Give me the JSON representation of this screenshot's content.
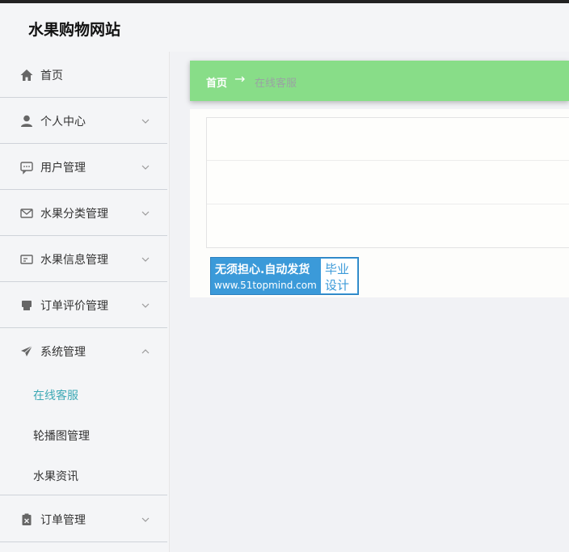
{
  "header": {
    "site_title": "水果购物网站"
  },
  "sidebar": {
    "items": [
      {
        "label": "首页",
        "icon": "home-icon",
        "expandable": false
      },
      {
        "label": "个人中心",
        "icon": "user-icon",
        "expandable": true
      },
      {
        "label": "用户管理",
        "icon": "chat-icon",
        "expandable": true
      },
      {
        "label": "水果分类管理",
        "icon": "mail-icon",
        "expandable": true
      },
      {
        "label": "水果信息管理",
        "icon": "card-icon",
        "expandable": true
      },
      {
        "label": "订单评价管理",
        "icon": "printer-icon",
        "expandable": true
      },
      {
        "label": "系统管理",
        "icon": "send-icon",
        "expandable": true,
        "expanded": true
      },
      {
        "label": "订单管理",
        "icon": "clipboard-icon",
        "expandable": true
      }
    ],
    "submenu": [
      {
        "label": "在线客服",
        "active": true
      },
      {
        "label": "轮播图管理",
        "active": false
      },
      {
        "label": "水果资讯",
        "active": false
      }
    ]
  },
  "breadcrumb": {
    "home": "首页",
    "separator": "→",
    "current": "在线客服"
  },
  "ad": {
    "line1": "无须担心.自动发货",
    "line2": "www.51topmind.com",
    "right1": "毕业",
    "right2": "设计"
  },
  "colors": {
    "breadcrumb_bg": "#88dd88",
    "active_submenu": "#3ea9b5",
    "ad_blue": "#3b9ad9"
  }
}
